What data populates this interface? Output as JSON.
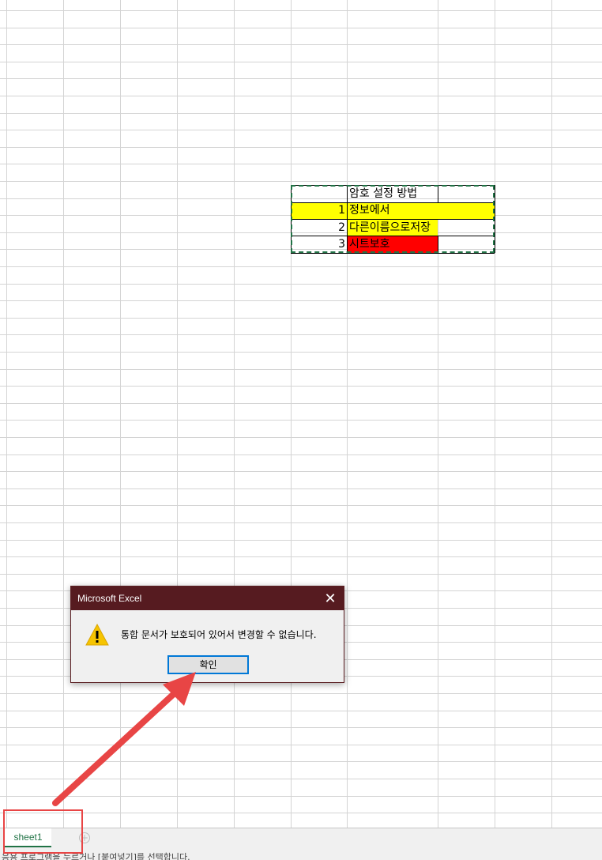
{
  "sheet": {
    "rows": [
      {
        "a": "",
        "b": "암호 설정 방법",
        "fill": ""
      },
      {
        "a": "1",
        "b": "정보에서",
        "fill": "yellow"
      },
      {
        "a": "2",
        "b": "다른이름으로저장",
        "fill": "yellow-partial"
      },
      {
        "a": "3",
        "b": "시트보호",
        "fill": "red"
      }
    ]
  },
  "dialog": {
    "title": "Microsoft Excel",
    "close_glyph": "✕",
    "icon": "warning-icon",
    "message": "통합 문서가 보호되어 있어서 변경할 수 없습니다.",
    "ok_label": "확인"
  },
  "tabs": {
    "active": "sheet1",
    "add_glyph": "+"
  },
  "status": {
    "text": "응용 프로그램을 누르거나 [붙여넣기]를 선택합니다."
  },
  "colors": {
    "yellow": "#ffff00",
    "red": "#ff0000",
    "dialog_title_bg": "#561b20",
    "selection_marquee": "#217346",
    "annotation": "#e84545"
  }
}
